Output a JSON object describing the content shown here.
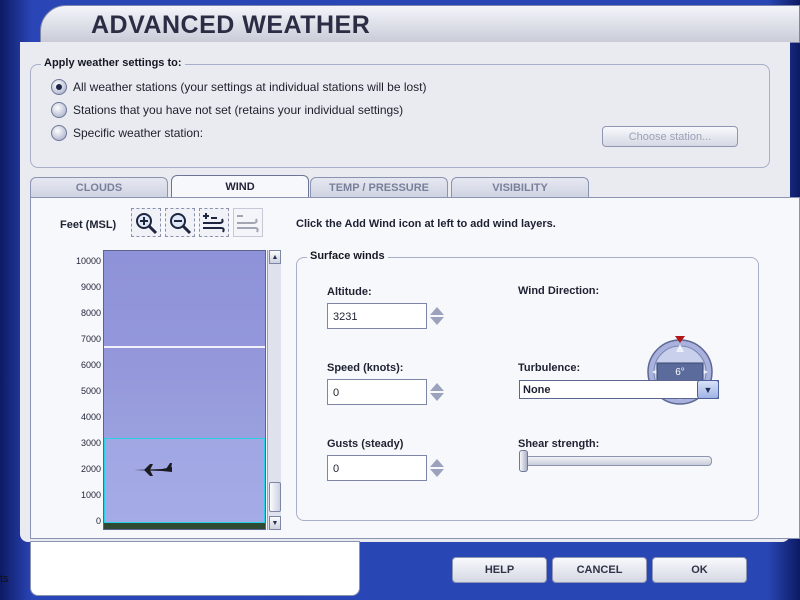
{
  "window": {
    "title": "ADVANCED WEATHER"
  },
  "apply": {
    "legend": "Apply weather settings to:",
    "options": [
      {
        "label": "All weather stations (your settings at individual stations will be lost)",
        "selected": true
      },
      {
        "label": "Stations that you have not set (retains your individual settings)",
        "selected": false
      },
      {
        "label": "Specific weather station:",
        "selected": false
      }
    ],
    "choose_station": "Choose station..."
  },
  "tabs": [
    {
      "label": "CLOUDS",
      "active": false
    },
    {
      "label": "WIND",
      "active": true
    },
    {
      "label": "TEMP / PRESSURE",
      "active": false
    },
    {
      "label": "VISIBILITY",
      "active": false
    }
  ],
  "wind": {
    "scale_label": "Feet (MSL)",
    "instruction": "Click the Add Wind icon at left to add wind layers.",
    "scale_ticks": [
      "10000",
      "9000",
      "8000",
      "7000",
      "6000",
      "5000",
      "4000",
      "3000",
      "2000",
      "1000",
      "0"
    ],
    "surface": {
      "legend": "Surface winds",
      "altitude_label": "Altitude:",
      "altitude_value": "3231",
      "speed_label": "Speed (knots):",
      "speed_value": "0",
      "gusts_label": "Gusts (steady)",
      "gusts_value": "0",
      "direction_label": "Wind Direction:",
      "direction_value": "6°",
      "turbulence_label": "Turbulence:",
      "turbulence_value": "None",
      "shear_label": "Shear strength:",
      "shear_level": 0
    }
  },
  "footer": {
    "left_label": "ts",
    "help": "HELP",
    "cancel": "CANCEL",
    "ok": "OK"
  },
  "colors": {
    "frame_blue": "#2846b4",
    "panel_bg": "#eaebf1",
    "sky": "#9497da",
    "highlight": "#26d0e6"
  }
}
